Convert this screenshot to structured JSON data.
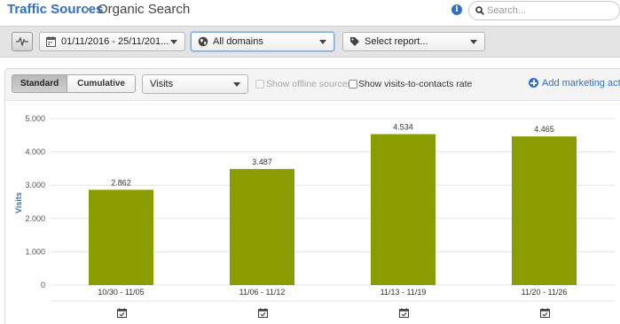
{
  "header": {
    "breadcrumb_root": "Traffic Sources",
    "breadcrumb_separator": "▸",
    "breadcrumb_current": "Organic Search",
    "search_placeholder": "Search..."
  },
  "toolbar": {
    "date_range": "01/11/2016 - 25/11/201...",
    "domain_filter": "All domains",
    "report_select": "Select report..."
  },
  "chart_controls": {
    "standard_label": "Standard",
    "cumulative_label": "Cumulative",
    "metric_value": "Visits",
    "offline_label": "Show offline sources",
    "offline_checked": false,
    "offline_disabled": true,
    "contacts_rate_label": "Show visits-to-contacts rate",
    "contacts_rate_checked": false,
    "add_action_label": "Add marketing action"
  },
  "colors": {
    "brand_blue": "#2f6fc9",
    "bar": "#8a9c00"
  },
  "chart_data": {
    "type": "bar",
    "categories": [
      "10/30 - 11/05",
      "11/06 - 11/12",
      "11/13 - 11/19",
      "11/20 - 11/26"
    ],
    "values": [
      2862,
      3487,
      4534,
      4465
    ],
    "value_labels": [
      "2.862",
      "3.487",
      "4.534",
      "4.465"
    ],
    "ylabel": "Visits",
    "ylim": [
      0,
      5000
    ],
    "yticks": [
      0,
      1000,
      2000,
      3000,
      4000,
      5000
    ],
    "ytick_labels": [
      "0",
      "1.000",
      "2.000",
      "3.000",
      "4.000",
      "5.000"
    ],
    "grid": true,
    "legend": "none"
  }
}
